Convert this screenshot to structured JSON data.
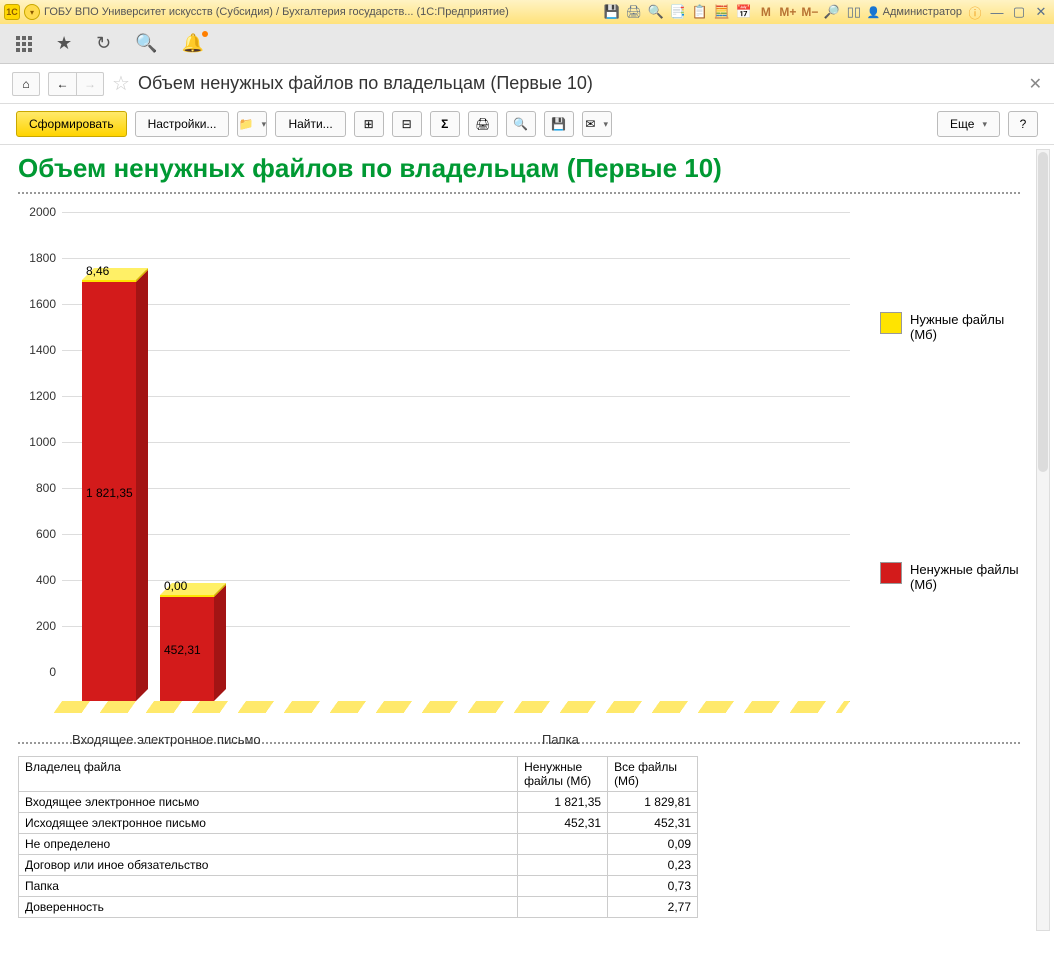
{
  "titlebar": {
    "app_title": "ГОБУ ВПО Университет искусств (Субсидия) / Бухгалтерия государств... (1С:Предприятие)",
    "user_label": "Администратор",
    "memory_m": "M",
    "memory_mplus": "M+",
    "memory_mminus": "M−"
  },
  "header": {
    "page_title": "Объем ненужных файлов по владельцам (Первые 10)"
  },
  "toolbar": {
    "form_label": "Сформировать",
    "settings_label": "Настройки...",
    "find_label": "Найти...",
    "more_label": "Еще",
    "help_label": "?"
  },
  "report": {
    "title": "Объем ненужных файлов по владельцам (Первые 10)"
  },
  "chart_data": {
    "type": "bar",
    "categories": [
      "Входящее электронное письмо",
      "Исходящее электронное письмо",
      "Не определено",
      "Договор или иное обязательство",
      "Папка",
      "Доверенность",
      "",
      "",
      "",
      ""
    ],
    "x_visible_labels": [
      "Входящее электронное письмо",
      "Папка"
    ],
    "series": [
      {
        "name": "Ненужные файлы (Мб)",
        "color": "#d31b1b",
        "values": [
          1821.35,
          452.31,
          0,
          0,
          0,
          0,
          0,
          0,
          0,
          0
        ]
      },
      {
        "name": "Нужные файлы (Мб)",
        "color": "#ffe400",
        "values": [
          8.46,
          0.0,
          0.09,
          0.23,
          0.73,
          2.77,
          0,
          0,
          0,
          0
        ]
      }
    ],
    "ylim": [
      0,
      2000
    ],
    "ytick": 200,
    "bar_labels": [
      {
        "cat": 0,
        "series": 0,
        "text": "1 821,35"
      },
      {
        "cat": 0,
        "series": 1,
        "text": "8,46"
      },
      {
        "cat": 1,
        "series": 0,
        "text": "452,31"
      },
      {
        "cat": 1,
        "series": 1,
        "text": "0,00"
      }
    ]
  },
  "legend": {
    "items": [
      {
        "label": "Нужные файлы (Мб)",
        "color": "#ffe400"
      },
      {
        "label": "Ненужные файлы (Мб)",
        "color": "#d31b1b"
      }
    ]
  },
  "table": {
    "headers": {
      "owner": "Владелец файла",
      "unneeded": "Ненужные файлы (Мб)",
      "all": "Все файлы (Мб)"
    },
    "rows": [
      {
        "owner": "Входящее электронное письмо",
        "unneeded": "1 821,35",
        "all": "1 829,81"
      },
      {
        "owner": "Исходящее электронное письмо",
        "unneeded": "452,31",
        "all": "452,31"
      },
      {
        "owner": "Не определено",
        "unneeded": "",
        "all": "0,09"
      },
      {
        "owner": "Договор или иное обязательство",
        "unneeded": "",
        "all": "0,23"
      },
      {
        "owner": "Папка",
        "unneeded": "",
        "all": "0,73"
      },
      {
        "owner": "Доверенность",
        "unneeded": "",
        "all": "2,77"
      }
    ]
  }
}
